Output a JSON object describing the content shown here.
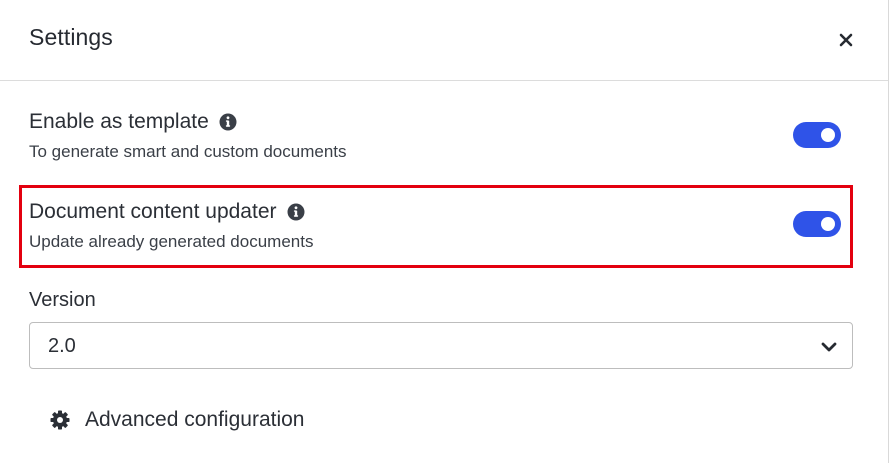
{
  "header": {
    "title": "Settings",
    "close_icon": "close-icon"
  },
  "settings": [
    {
      "label": "Enable as template",
      "description": "To generate smart and custom documents",
      "enabled": true,
      "info_icon": "info-icon"
    },
    {
      "label": "Document content updater",
      "description": "Update already generated documents",
      "enabled": true,
      "info_icon": "info-icon",
      "highlighted": true
    }
  ],
  "version": {
    "label": "Version",
    "selected": "2.0",
    "chevron_icon": "chevron-down-icon"
  },
  "advanced": {
    "label": "Advanced configuration",
    "icon": "gear-icon"
  },
  "colors": {
    "toggle_on": "#2f53e8",
    "highlight": "#e3000f"
  }
}
